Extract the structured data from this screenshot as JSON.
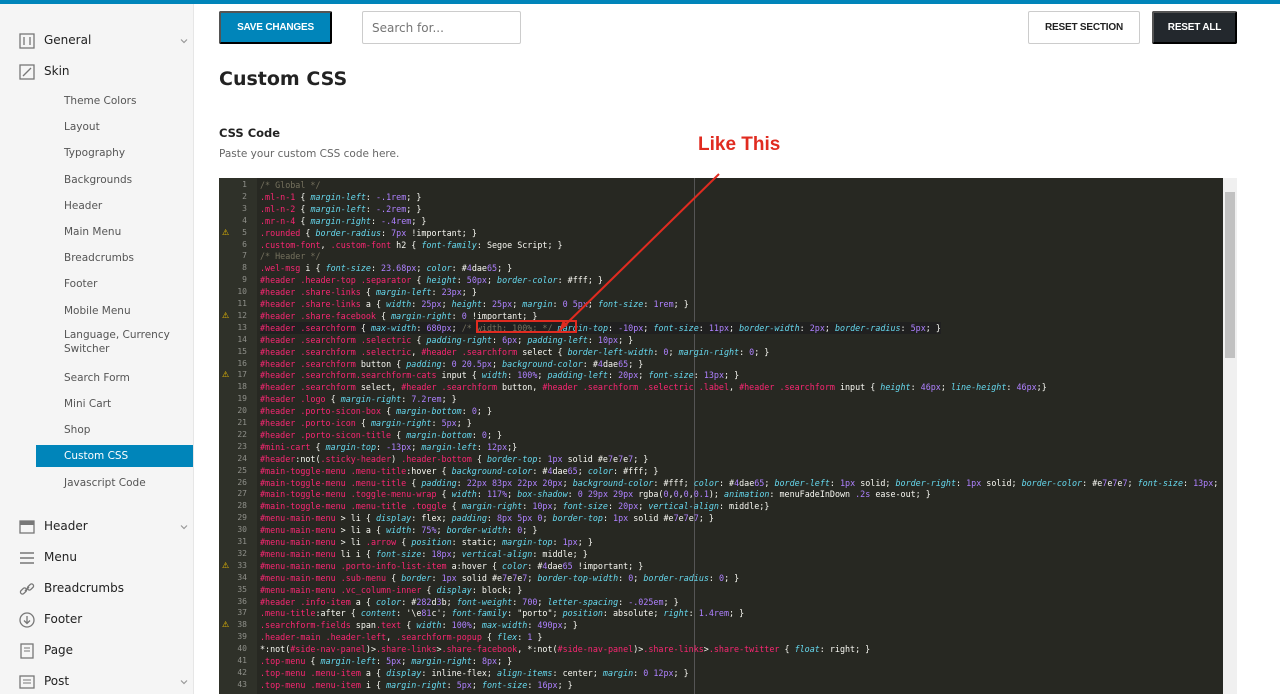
{
  "sidebar": {
    "top_items": [
      {
        "label": "General",
        "icon": "sliders-icon",
        "chevron": true
      },
      {
        "label": "Skin",
        "icon": "skin-icon",
        "chevron": false
      },
      {
        "label": "Header",
        "icon": "header-icon",
        "chevron": true
      },
      {
        "label": "Menu",
        "icon": "menu-icon",
        "chevron": false
      },
      {
        "label": "Breadcrumbs",
        "icon": "link-icon",
        "chevron": false
      },
      {
        "label": "Footer",
        "icon": "footer-icon",
        "chevron": false
      },
      {
        "label": "Page",
        "icon": "page-icon",
        "chevron": false
      },
      {
        "label": "Post",
        "icon": "post-icon",
        "chevron": true
      }
    ],
    "skin_sub": [
      "Theme Colors",
      "Layout",
      "Typography",
      "Backgrounds",
      "Header",
      "Main Menu",
      "Breadcrumbs",
      "Footer",
      "Mobile Menu",
      "Language, Currency Switcher",
      "Search Form",
      "Mini Cart",
      "Shop",
      "Custom CSS",
      "Javascript Code"
    ],
    "active": "Custom CSS"
  },
  "toolbar": {
    "save_label": "SAVE CHANGES",
    "search_placeholder": "Search for...",
    "reset_section_label": "RESET SECTION",
    "reset_all_label": "RESET ALL"
  },
  "section": {
    "title": "Custom CSS",
    "field_label": "CSS Code",
    "field_description": "Paste your custom CSS code here."
  },
  "annotation": {
    "text": "Like This",
    "color": "#e02b20"
  },
  "colors": {
    "accent": "#0085ba",
    "dark": "#23282d",
    "editor_bg": "#272822",
    "selector": "#f92672",
    "property": "#66d9ef",
    "number": "#ae81ff",
    "comment": "#75715e"
  },
  "editor": {
    "warning_lines": [
      5,
      12,
      17,
      33,
      38
    ],
    "lines": [
      "/* Global */",
      ".ml-n-1 { margin-left: -.1rem; }",
      ".ml-n-2 { margin-left: -.2rem; }",
      ".mr-n-4 { margin-right: -.4rem; }",
      ".rounded { border-radius: 7px !important; }",
      ".custom-font, .custom-font h2 { font-family: Segoe Script; }",
      "/* Header */",
      ".wel-msg i { font-size: 23.68px; color: #4dae65; }",
      "#header .header-top .separator { height: 50px; border-color: #fff; }",
      "#header .share-links { margin-left: 23px; }",
      "#header .share-links a { width: 25px; height: 25px; margin: 0 5px; font-size: 1rem; }",
      "#header .share-facebook { margin-right: 0 !important; }",
      "#header .searchform { max-width: 680px; /* width: 100%; */ margin-top: -10px; font-size: 11px; border-width: 2px; border-radius: 5px; }",
      "#header .searchform .selectric { padding-right: 6px; padding-left: 10px; }",
      "#header .searchform .selectric, #header .searchform select { border-left-width: 0; margin-right: 0; }",
      "#header .searchform button { padding: 0 20.5px; background-color: #4dae65; }",
      "#header .searchform.searchform-cats input { width: 100%; padding-left: 20px; font-size: 13px; }",
      "#header .searchform select, #header .searchform button, #header .searchform .selectric .label, #header .searchform input { height: 46px; line-height: 46px;}",
      "#header .logo { margin-right: 7.2rem; }",
      "#header .porto-sicon-box { margin-bottom: 0; }",
      "#header .porto-icon { margin-right: 5px; }",
      "#header .porto-sicon-title { margin-bottom: 0; }",
      "#mini-cart { margin-top: -13px; margin-left: 12px;}",
      "#header:not(.sticky-header) .header-bottom { border-top: 1px solid #e7e7e7; }",
      "#main-toggle-menu .menu-title:hover { background-color: #4dae65; color: #fff; }",
      "#main-toggle-menu .menu-title { padding: 22px 83px 22px 20px; background-color: #fff; color: #4dae65; border-left: 1px solid; border-right: 1px solid; border-color: #e7e7e7; font-size: 13px;",
      "#main-toggle-menu .toggle-menu-wrap { width: 117%; box-shadow: 0 29px 29px rgba(0,0,0,0.1); animation: menuFadeInDown .2s ease-out; }",
      "#main-toggle-menu .menu-title .toggle { margin-right: 10px; font-size: 20px; vertical-align: middle;}",
      "#menu-main-menu > li { display: flex; padding: 8px 5px 0; border-top: 1px solid #e7e7e7; }",
      "#menu-main-menu > li a { width: 75%; border-width: 0; }",
      "#menu-main-menu > li .arrow { position: static; margin-top: 1px; }",
      "#menu-main-menu li i { font-size: 18px; vertical-align: middle; }",
      "#menu-main-menu .porto-info-list-item a:hover { color: #4dae65 !important; }",
      "#menu-main-menu .sub-menu { border: 1px solid #e7e7e7; border-top-width: 0; border-radius: 0; }",
      "#menu-main-menu .vc_column-inner { display: block; }",
      "#header .info-item a { color: #282d3b; font-weight: 700; letter-spacing: -.025em; }",
      ".menu-title:after { content: '\\e81c'; font-family: \"porto\"; position: absolute; right: 1.4rem; }",
      ".searchform-fields span.text { width: 100%; max-width: 490px; }",
      ".header-main .header-left, .searchform-popup { flex: 1 }",
      "*:not(#side-nav-panel)>.share-links>.share-facebook, *:not(#side-nav-panel)>.share-links>.share-twitter { float: right; }",
      ".top-menu { margin-left: 5px; margin-right: 8px; }",
      ".top-menu .menu-item a { display: inline-flex; align-items: center; margin: 0 12px; }",
      ".top-menu .menu-item i { margin-right: 5px; font-size: 16px; }"
    ]
  }
}
